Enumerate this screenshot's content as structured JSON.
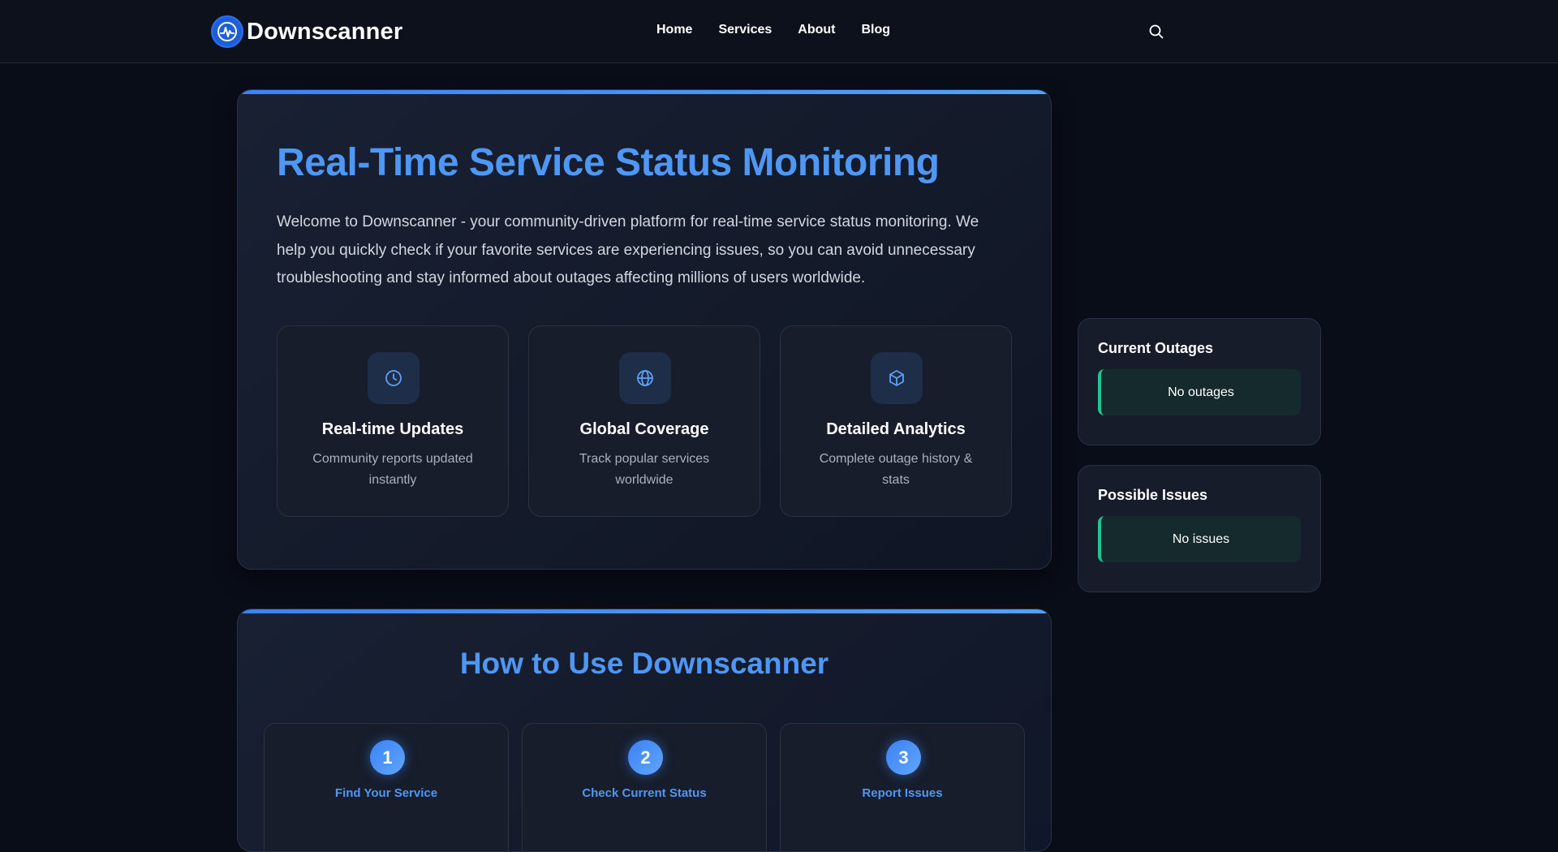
{
  "brand": {
    "name": "Downscanner",
    "logo_icon": "wave-logo-icon"
  },
  "nav": {
    "links": [
      "Home",
      "Services",
      "About",
      "Blog"
    ],
    "search_icon": "search-icon"
  },
  "hero": {
    "title": "Real-Time Service Status Monitoring",
    "description": "Welcome to Downscanner - your community-driven platform for real-time service status monitoring. We help you quickly check if your favorite services are experiencing issues, so you can avoid unnecessary troubleshooting and stay informed about outages affecting millions of users worldwide.",
    "features": [
      {
        "icon": "clock-icon",
        "title": "Real-time Updates",
        "description": "Community reports updated instantly"
      },
      {
        "icon": "globe-icon",
        "title": "Global Coverage",
        "description": "Track popular services worldwide"
      },
      {
        "icon": "cube-icon",
        "title": "Detailed Analytics",
        "description": "Complete outage history & stats"
      }
    ]
  },
  "sidebar": {
    "outages": {
      "title": "Current Outages",
      "status": "No outages"
    },
    "issues": {
      "title": "Possible Issues",
      "status": "No issues"
    }
  },
  "how_to": {
    "title": "How to Use Downscanner",
    "steps": [
      {
        "number": "1",
        "title": "Find Your Service"
      },
      {
        "number": "2",
        "title": "Check Current Status"
      },
      {
        "number": "3",
        "title": "Report Issues"
      }
    ]
  },
  "colors": {
    "accent": "#4f97f5",
    "status_ok": "#22c58e",
    "background": "#090d18"
  }
}
